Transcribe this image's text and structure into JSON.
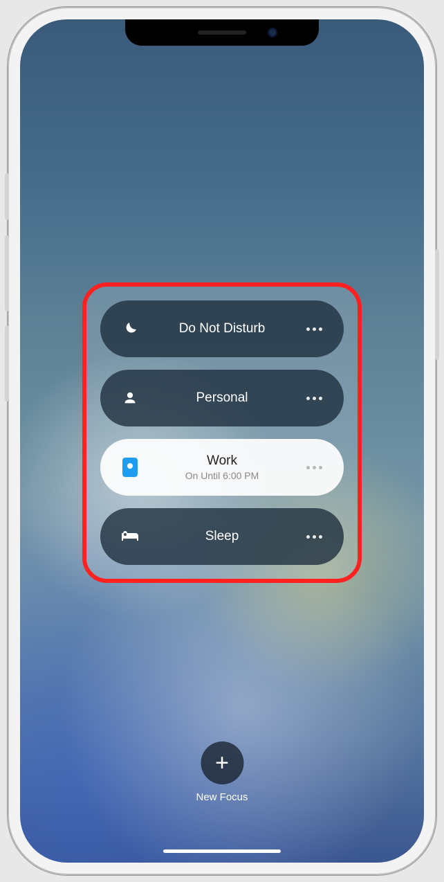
{
  "focus_modes": [
    {
      "label": "Do Not Disturb",
      "active": false,
      "sub": ""
    },
    {
      "label": "Personal",
      "active": false,
      "sub": ""
    },
    {
      "label": "Work",
      "active": true,
      "sub": "On Until 6:00 PM"
    },
    {
      "label": "Sleep",
      "active": false,
      "sub": ""
    }
  ],
  "new_focus": {
    "label": "New Focus",
    "glyph": "+"
  }
}
